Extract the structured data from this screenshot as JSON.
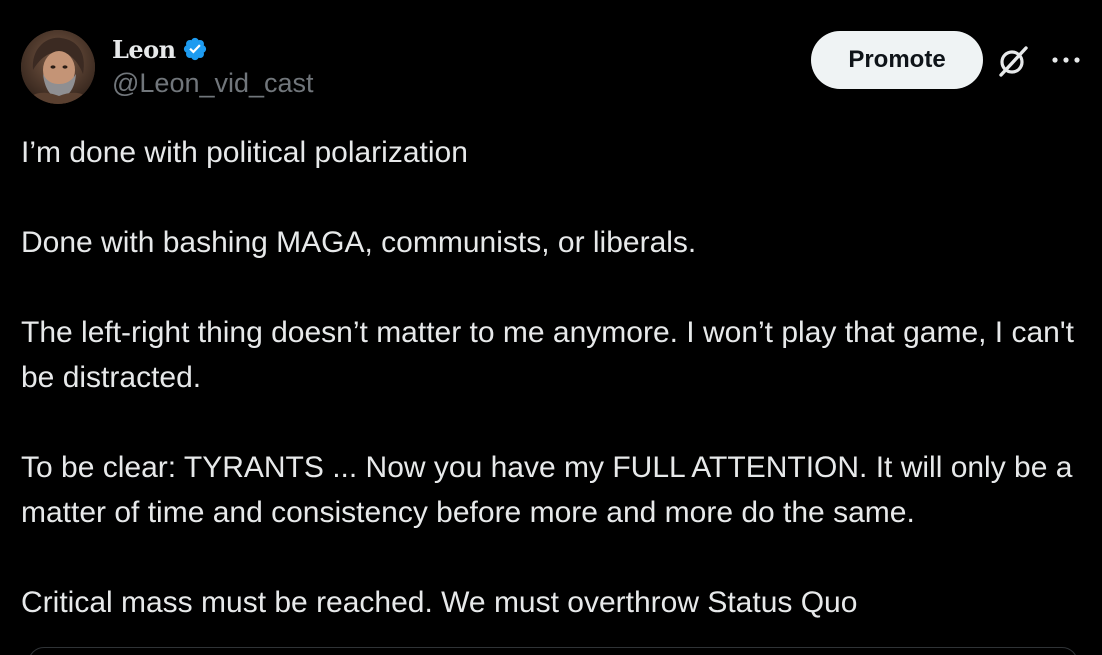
{
  "user": {
    "display_name": "Leon",
    "handle": "@Leon_vid_cast",
    "verified": true,
    "verified_color": "#1d9bf0"
  },
  "actions": {
    "promote_label": "Promote",
    "grok_icon": "grok-icon",
    "more_icon": "more-horizontal-icon"
  },
  "tweet": {
    "lines": [
      "I’m done with political polarization",
      "Done with bashing MAGA, communists, or liberals.",
      "The left-right thing doesn’t matter to me anymore. I won’t play that game, I can't be distracted.",
      "To be clear:  TYRANTS ... Now you have my FULL ATTENTION. It will only be a matter of time and consistency before more and more do the same.",
      "Critical mass must be reached. We must overthrow Status Quo"
    ]
  },
  "colors": {
    "background": "#000000",
    "text_primary": "#e7e9ea",
    "text_secondary": "#71767b",
    "button_bg": "#eff3f4",
    "button_text": "#0f1419"
  }
}
